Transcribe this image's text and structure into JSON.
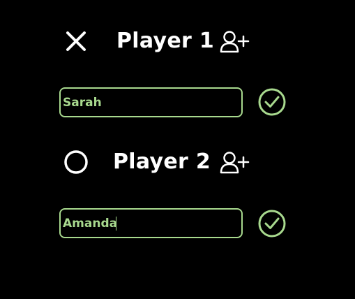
{
  "colors": {
    "background": "#000000",
    "accent": "#a8d98e",
    "text": "#ffffff"
  },
  "players": [
    {
      "title": "Player 1",
      "symbol_icon": "x-icon",
      "name_value": "Sarah",
      "add_icon": "add-user-icon",
      "confirm_icon": "check-circle-icon"
    },
    {
      "title": "Player 2",
      "symbol_icon": "o-icon",
      "name_value": "Amanda",
      "add_icon": "add-user-icon",
      "confirm_icon": "check-circle-icon"
    }
  ]
}
